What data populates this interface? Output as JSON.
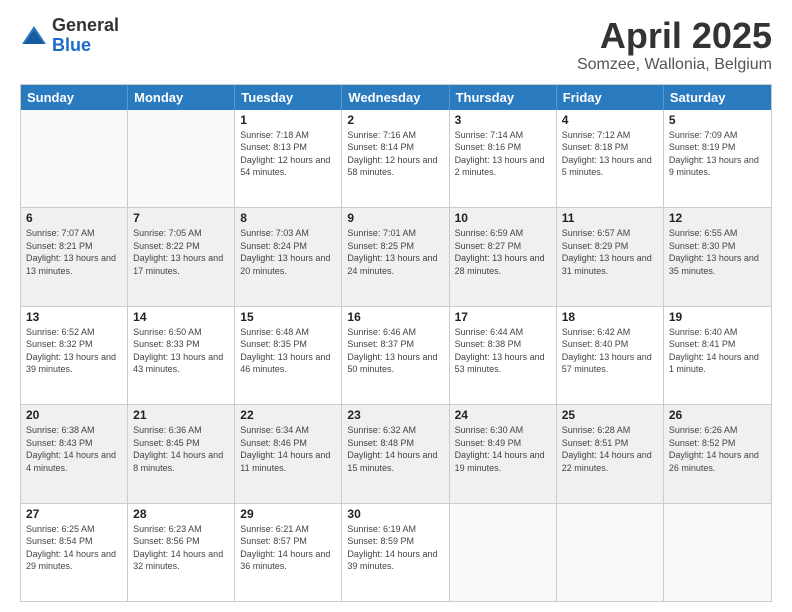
{
  "logo": {
    "general": "General",
    "blue": "Blue"
  },
  "header": {
    "title": "April 2025",
    "subtitle": "Somzee, Wallonia, Belgium"
  },
  "days": [
    "Sunday",
    "Monday",
    "Tuesday",
    "Wednesday",
    "Thursday",
    "Friday",
    "Saturday"
  ],
  "weeks": [
    [
      {
        "day": "",
        "sunrise": "",
        "sunset": "",
        "daylight": "",
        "empty": true
      },
      {
        "day": "",
        "sunrise": "",
        "sunset": "",
        "daylight": "",
        "empty": true
      },
      {
        "day": "1",
        "sunrise": "Sunrise: 7:18 AM",
        "sunset": "Sunset: 8:13 PM",
        "daylight": "Daylight: 12 hours and 54 minutes."
      },
      {
        "day": "2",
        "sunrise": "Sunrise: 7:16 AM",
        "sunset": "Sunset: 8:14 PM",
        "daylight": "Daylight: 12 hours and 58 minutes."
      },
      {
        "day": "3",
        "sunrise": "Sunrise: 7:14 AM",
        "sunset": "Sunset: 8:16 PM",
        "daylight": "Daylight: 13 hours and 2 minutes."
      },
      {
        "day": "4",
        "sunrise": "Sunrise: 7:12 AM",
        "sunset": "Sunset: 8:18 PM",
        "daylight": "Daylight: 13 hours and 5 minutes."
      },
      {
        "day": "5",
        "sunrise": "Sunrise: 7:09 AM",
        "sunset": "Sunset: 8:19 PM",
        "daylight": "Daylight: 13 hours and 9 minutes."
      }
    ],
    [
      {
        "day": "6",
        "sunrise": "Sunrise: 7:07 AM",
        "sunset": "Sunset: 8:21 PM",
        "daylight": "Daylight: 13 hours and 13 minutes."
      },
      {
        "day": "7",
        "sunrise": "Sunrise: 7:05 AM",
        "sunset": "Sunset: 8:22 PM",
        "daylight": "Daylight: 13 hours and 17 minutes."
      },
      {
        "day": "8",
        "sunrise": "Sunrise: 7:03 AM",
        "sunset": "Sunset: 8:24 PM",
        "daylight": "Daylight: 13 hours and 20 minutes."
      },
      {
        "day": "9",
        "sunrise": "Sunrise: 7:01 AM",
        "sunset": "Sunset: 8:25 PM",
        "daylight": "Daylight: 13 hours and 24 minutes."
      },
      {
        "day": "10",
        "sunrise": "Sunrise: 6:59 AM",
        "sunset": "Sunset: 8:27 PM",
        "daylight": "Daylight: 13 hours and 28 minutes."
      },
      {
        "day": "11",
        "sunrise": "Sunrise: 6:57 AM",
        "sunset": "Sunset: 8:29 PM",
        "daylight": "Daylight: 13 hours and 31 minutes."
      },
      {
        "day": "12",
        "sunrise": "Sunrise: 6:55 AM",
        "sunset": "Sunset: 8:30 PM",
        "daylight": "Daylight: 13 hours and 35 minutes."
      }
    ],
    [
      {
        "day": "13",
        "sunrise": "Sunrise: 6:52 AM",
        "sunset": "Sunset: 8:32 PM",
        "daylight": "Daylight: 13 hours and 39 minutes."
      },
      {
        "day": "14",
        "sunrise": "Sunrise: 6:50 AM",
        "sunset": "Sunset: 8:33 PM",
        "daylight": "Daylight: 13 hours and 43 minutes."
      },
      {
        "day": "15",
        "sunrise": "Sunrise: 6:48 AM",
        "sunset": "Sunset: 8:35 PM",
        "daylight": "Daylight: 13 hours and 46 minutes."
      },
      {
        "day": "16",
        "sunrise": "Sunrise: 6:46 AM",
        "sunset": "Sunset: 8:37 PM",
        "daylight": "Daylight: 13 hours and 50 minutes."
      },
      {
        "day": "17",
        "sunrise": "Sunrise: 6:44 AM",
        "sunset": "Sunset: 8:38 PM",
        "daylight": "Daylight: 13 hours and 53 minutes."
      },
      {
        "day": "18",
        "sunrise": "Sunrise: 6:42 AM",
        "sunset": "Sunset: 8:40 PM",
        "daylight": "Daylight: 13 hours and 57 minutes."
      },
      {
        "day": "19",
        "sunrise": "Sunrise: 6:40 AM",
        "sunset": "Sunset: 8:41 PM",
        "daylight": "Daylight: 14 hours and 1 minute."
      }
    ],
    [
      {
        "day": "20",
        "sunrise": "Sunrise: 6:38 AM",
        "sunset": "Sunset: 8:43 PM",
        "daylight": "Daylight: 14 hours and 4 minutes."
      },
      {
        "day": "21",
        "sunrise": "Sunrise: 6:36 AM",
        "sunset": "Sunset: 8:45 PM",
        "daylight": "Daylight: 14 hours and 8 minutes."
      },
      {
        "day": "22",
        "sunrise": "Sunrise: 6:34 AM",
        "sunset": "Sunset: 8:46 PM",
        "daylight": "Daylight: 14 hours and 11 minutes."
      },
      {
        "day": "23",
        "sunrise": "Sunrise: 6:32 AM",
        "sunset": "Sunset: 8:48 PM",
        "daylight": "Daylight: 14 hours and 15 minutes."
      },
      {
        "day": "24",
        "sunrise": "Sunrise: 6:30 AM",
        "sunset": "Sunset: 8:49 PM",
        "daylight": "Daylight: 14 hours and 19 minutes."
      },
      {
        "day": "25",
        "sunrise": "Sunrise: 6:28 AM",
        "sunset": "Sunset: 8:51 PM",
        "daylight": "Daylight: 14 hours and 22 minutes."
      },
      {
        "day": "26",
        "sunrise": "Sunrise: 6:26 AM",
        "sunset": "Sunset: 8:52 PM",
        "daylight": "Daylight: 14 hours and 26 minutes."
      }
    ],
    [
      {
        "day": "27",
        "sunrise": "Sunrise: 6:25 AM",
        "sunset": "Sunset: 8:54 PM",
        "daylight": "Daylight: 14 hours and 29 minutes."
      },
      {
        "day": "28",
        "sunrise": "Sunrise: 6:23 AM",
        "sunset": "Sunset: 8:56 PM",
        "daylight": "Daylight: 14 hours and 32 minutes."
      },
      {
        "day": "29",
        "sunrise": "Sunrise: 6:21 AM",
        "sunset": "Sunset: 8:57 PM",
        "daylight": "Daylight: 14 hours and 36 minutes."
      },
      {
        "day": "30",
        "sunrise": "Sunrise: 6:19 AM",
        "sunset": "Sunset: 8:59 PM",
        "daylight": "Daylight: 14 hours and 39 minutes."
      },
      {
        "day": "",
        "sunrise": "",
        "sunset": "",
        "daylight": "",
        "empty": true
      },
      {
        "day": "",
        "sunrise": "",
        "sunset": "",
        "daylight": "",
        "empty": true
      },
      {
        "day": "",
        "sunrise": "",
        "sunset": "",
        "daylight": "",
        "empty": true
      }
    ]
  ]
}
